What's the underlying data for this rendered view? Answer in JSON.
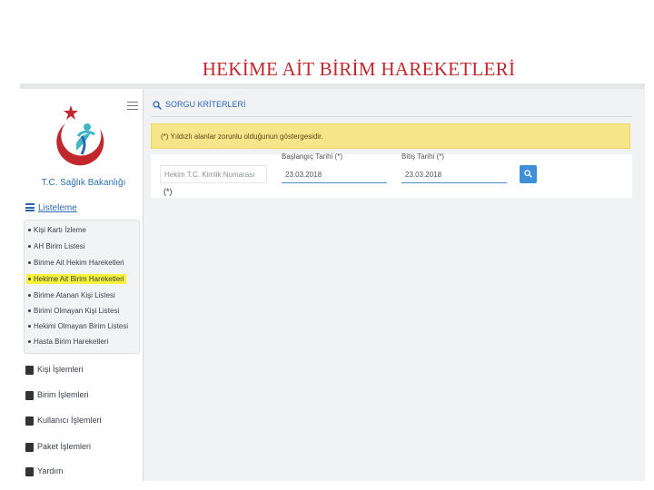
{
  "slide_title": "HEKİME AİT BİRİM HAREKETLERİ",
  "brand": "T.C. Sağlık Bakanlığı",
  "sidebar": {
    "list_heading": "Listeleme",
    "list_items": [
      "Kişi Kartı İzleme",
      "AH Birim Listesi",
      "Birime Ait Hekim Hareketleri",
      "Hekime Ait Birim Hareketleri",
      "Birime Atanan Kişi Listesi",
      "Birimi Olmayan Kişi Listesi",
      "Hekimi Olmayan Birim Listesi",
      "Hasta Birim Hareketleri"
    ],
    "active_item": "Hekime Ait Birim Hareketleri",
    "nav_items": [
      {
        "label": "Kişi İşlemleri",
        "icon": "user-card-icon"
      },
      {
        "label": "Birim İşlemleri",
        "icon": "id-card-icon"
      },
      {
        "label": "Kullanıcı İşlemleri",
        "icon": "user-icon"
      },
      {
        "label": "Paket İşlemleri",
        "icon": "folder-icon"
      },
      {
        "label": "Yardım",
        "icon": "help-icon"
      }
    ]
  },
  "panel": {
    "title": "SORGU KRİTERLERİ",
    "warning": "(*) Yıldızlı alanlar zorunlu olduğunun göstergesidir."
  },
  "form": {
    "tc_placeholder": "Hekim T.C. Kimlik Numarası",
    "tc_required": "(*)",
    "start_label": "Başlangıç Tarihi (*)",
    "start_value": "23.03.2018",
    "end_label": "Bitiş Tarihi (*)",
    "end_value": "23.03.2018"
  },
  "colors": {
    "title": "#c0282e",
    "accent": "#2f66b3",
    "highlight": "#f7f33a",
    "warning_bg": "#f7e58a",
    "button": "#3f8fd8"
  }
}
